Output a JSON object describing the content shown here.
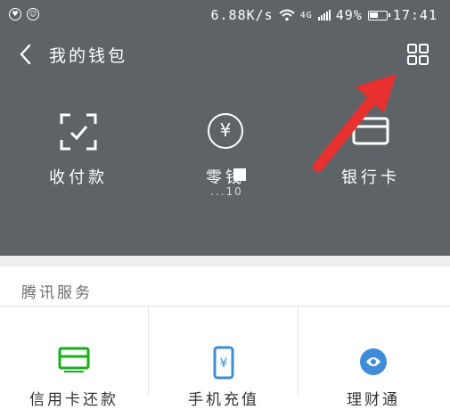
{
  "status_bar": {
    "speed": "6.88K/s",
    "network": "4G",
    "battery": "49%",
    "time": "17:41"
  },
  "header": {
    "title": "我的钱包"
  },
  "wallet": {
    "items": [
      {
        "label": "收付款",
        "icon": "scan-pay-icon"
      },
      {
        "label": "零钱",
        "icon": "yen-circle-icon"
      },
      {
        "label": "银行卡",
        "icon": "bank-card-icon"
      }
    ],
    "balance": "...10"
  },
  "services": {
    "section_title": "腾讯服务",
    "items": [
      {
        "label": "信用卡还款",
        "icon": "credit-card-icon",
        "color": "#1aad19"
      },
      {
        "label": "手机充值",
        "icon": "phone-recharge-icon",
        "color": "#3f8cd9"
      },
      {
        "label": "理财通",
        "icon": "wealth-icon",
        "color": "#3f8cd9"
      }
    ]
  },
  "colors": {
    "header_bg": "#5e6367",
    "arrow": "#e8312f"
  }
}
